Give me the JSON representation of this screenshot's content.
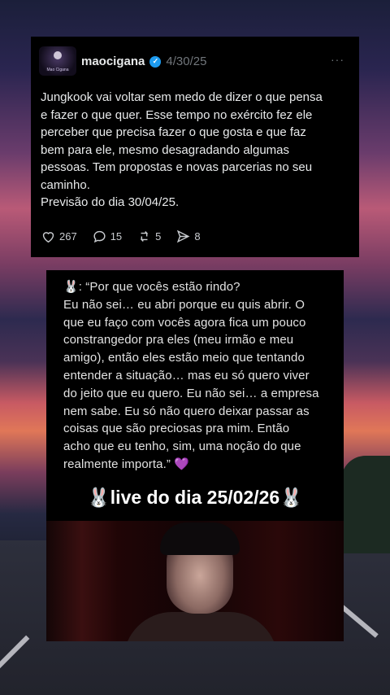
{
  "tweet": {
    "avatar_caption": "Mao Cigana",
    "handle": "maocigana",
    "date": "4/30/25",
    "more": "···",
    "verified_mark": "✓",
    "lines": [
      "Jungkook vai voltar sem medo de dizer o que pensa",
      "e fazer o que quer. Esse tempo no exército fez ele",
      "perceber que precisa fazer o que gosta e que faz",
      "bem para ele,  mesmo desagradando algumas",
      "pessoas. Tem propostas e novas parcerias no seu",
      "caminho.",
      "Previsão do dia 30/04/25."
    ],
    "actions": {
      "likes": "267",
      "replies": "15",
      "reposts": "5",
      "shares": "8"
    }
  },
  "quote": {
    "lines": [
      "🐰: “Por que vocês estão rindo?",
      "Eu não sei… eu abri porque eu quis abrir. O",
      "que eu faço com vocês agora fica um pouco",
      "constrangedor pra eles (meu irmão e meu",
      "amigo), então eles estão meio que tentando",
      "entender a situação… mas eu só quero viver",
      "do jeito que eu quero. Eu não sei… a empresa",
      "nem sabe. Eu só não quero deixar passar as",
      "coisas que são preciosas pra mim. Então",
      "acho que eu tenho, sim, uma noção do que",
      "realmente importa.” 💜"
    ],
    "live_title": "🐰live do dia 25/02/26🐰"
  },
  "colors": {
    "card_bg": "#000000",
    "verified_blue": "#1d9bf0",
    "muted_gray": "#71767b"
  }
}
